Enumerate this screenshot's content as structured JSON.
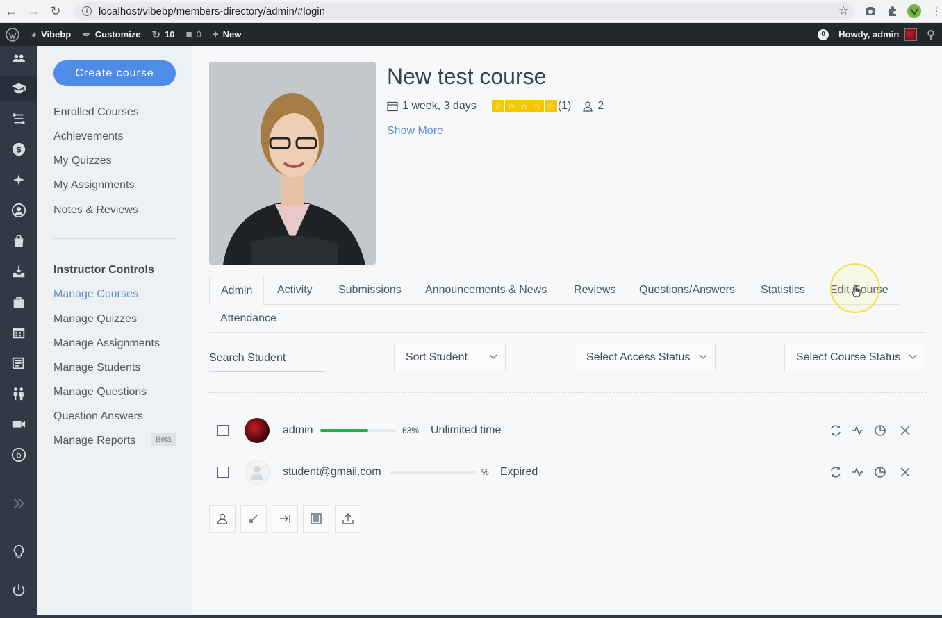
{
  "browser": {
    "url": "localhost/vibebp/members-directory/admin/#login"
  },
  "wpbar": {
    "site_name": "Vibebp",
    "customize": "Customize",
    "updates_count": "10",
    "comments_count": "0",
    "new_label": "New",
    "notif_count": "0",
    "howdy": "Howdy, admin"
  },
  "sidebar": {
    "create_button": "Create course",
    "links": [
      "Enrolled Courses",
      "Achievements",
      "My Quizzes",
      "My Assignments",
      "Notes & Reviews"
    ],
    "instructor_heading": "Instructor Controls",
    "instructor_links": [
      "Manage Courses",
      "Manage Quizzes",
      "Manage Assignments",
      "Manage Students",
      "Manage Questions",
      "Question Answers",
      "Manage Reports"
    ],
    "beta_label": "Beta"
  },
  "course": {
    "title": "New test course",
    "duration": "1 week, 3 days",
    "rating_count": "(1)",
    "rating": 5,
    "students": "2",
    "show_more": "Show More"
  },
  "tabs": [
    "Admin",
    "Activity",
    "Submissions",
    "Announcements & News",
    "Reviews",
    "Questions/Answers",
    "Statistics",
    "Edit Course",
    "Attendance"
  ],
  "filters": {
    "search_placeholder": "Search Student",
    "sort": "Sort Student",
    "access": "Select Access Status",
    "course_status": "Select Course Status"
  },
  "students": [
    {
      "name": "admin",
      "progress": 0.63,
      "percent_label": "63%",
      "status": "Unlimited time"
    },
    {
      "name": "student@gmail.com",
      "progress": 0,
      "percent_label": "%",
      "status": "Expired"
    }
  ],
  "colors": {
    "accent": "#4e8ce8",
    "rail": "#2f3a45",
    "progress": "#22b14c",
    "star": "#f6c600"
  }
}
